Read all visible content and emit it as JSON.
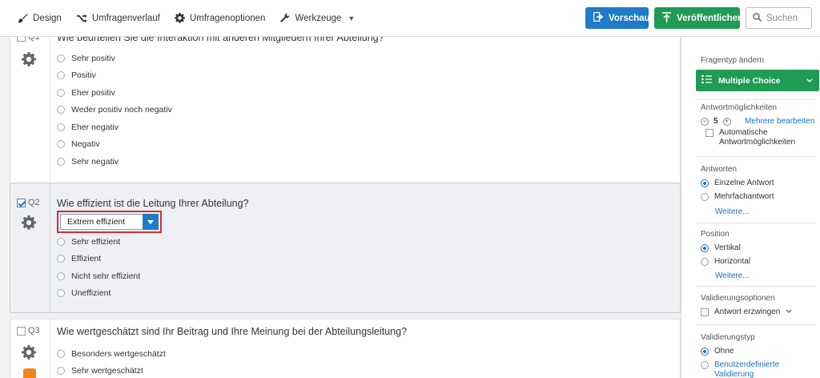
{
  "toolbar": {
    "nav": [
      {
        "label": "Design",
        "icon": "brush-icon"
      },
      {
        "label": "Umfragenverlauf",
        "icon": "flow-icon"
      },
      {
        "label": "Umfragenoptionen",
        "icon": "gear-icon"
      },
      {
        "label": "Werkzeuge",
        "icon": "wrench-icon"
      }
    ],
    "preview_label": "Vorschau",
    "publish_label": "Veröffentlichen",
    "search_placeholder": "Suchen",
    "colors": {
      "preview": "#1f7bc7",
      "publish": "#1f9b53"
    }
  },
  "questions": [
    {
      "number": "Q1",
      "text": "Wie beurteilen Sie die Interaktion mit anderen Mitgliedern Ihrer Abteilung?",
      "checked": false,
      "choices": [
        "Sehr positiv",
        "Positiv",
        "Eher positiv",
        "Weder positiv noch negativ",
        "Eher negativ",
        "Negativ",
        "Sehr negativ"
      ]
    },
    {
      "number": "Q2",
      "text": "Wie effizient ist die Leitung Ihrer Abteilung?",
      "checked": true,
      "selected": true,
      "editing_choice": "Extrem effizient",
      "choices": [
        "Sehr effizient",
        "Effizient",
        "Nicht sehr effizient",
        "Uneffizient"
      ]
    },
    {
      "number": "Q3",
      "text": "Wie wertgeschätzt sind Ihr Beitrag und Ihre Meinung bei der Abteilungsleitung?",
      "checked": false,
      "choices": [
        "Besonders wertgeschätzt",
        "Sehr wertgeschätzt"
      ]
    }
  ],
  "panel": {
    "question_type_label": "Fragentyp ändern",
    "question_type": "Multiple Choice",
    "answer_options_label": "Antwortmöglichkeiten",
    "answer_count": "5",
    "edit_multiple": "Mehrere bearbeiten",
    "auto_choices": "Automatische Antwortmöglichkeiten",
    "answers_label": "Antworten",
    "single_answer": "Einzelne Antwort",
    "multi_answer": "Mehrfachantwort",
    "more_1": "Weitere...",
    "position_label": "Position",
    "vertical": "Vertikal",
    "horizontal": "Horizontal",
    "more_2": "Weitere...",
    "validation_options_label": "Validierungsoptionen",
    "force_response": "Antwort erzwingen",
    "validation_type_label": "Validierungstyp",
    "none": "Ohne",
    "custom_validation": "Benutzerdefinierte Validierung"
  }
}
